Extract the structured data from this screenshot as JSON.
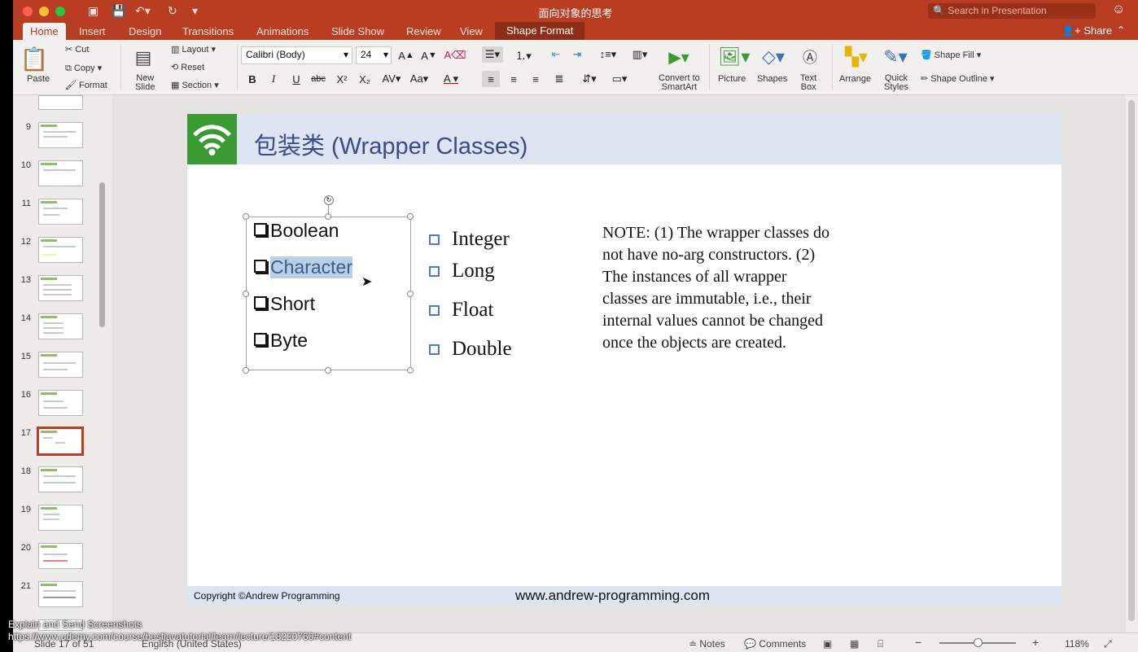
{
  "window": {
    "title": "面向对象的思考",
    "search_placeholder": "Search in Presentation",
    "share_label": "Share"
  },
  "tabs": [
    "Home",
    "Insert",
    "Design",
    "Transitions",
    "Animations",
    "Slide Show",
    "Review",
    "View",
    "Shape Format"
  ],
  "ribbon": {
    "clipboard": {
      "paste": "Paste",
      "cut": "Cut",
      "copy": "Copy",
      "format": "Format"
    },
    "slides": {
      "new_slide": "New Slide",
      "layout": "Layout",
      "reset": "Reset",
      "section": "Section"
    },
    "font": {
      "name": "Calibri (Body)",
      "size": "24",
      "bold": "B",
      "italic": "I",
      "underline": "U",
      "strike": "abc",
      "superscript": "X²",
      "subscript": "X₂"
    },
    "convert": "Convert to SmartArt",
    "picture": "Picture",
    "shapes": "Shapes",
    "textbox": "Text Box",
    "arrange": "Arrange",
    "quick_styles": "Quick Styles",
    "shape_fill": "Shape Fill",
    "shape_outline": "Shape Outline"
  },
  "thumbnails": {
    "numbers": [
      "9",
      "10",
      "11",
      "12",
      "13",
      "14",
      "15",
      "16",
      "17",
      "18",
      "19",
      "20",
      "21"
    ],
    "selected": "17"
  },
  "slide": {
    "title": "包装类 (Wrapper Classes)",
    "box_items": [
      "Boolean",
      "Character",
      "Short",
      "Byte"
    ],
    "list_items": [
      "Integer",
      "Long",
      "Float",
      "Double"
    ],
    "note_lines": [
      "NOTE: (1) The wrapper classes do",
      "not have no-arg constructors. (2)",
      "The instances of all wrapper",
      "classes are immutable, i.e., their",
      "internal values cannot be changed",
      "once the objects are created."
    ],
    "copyright": "Copyright ©Andrew Programming",
    "website": "www.andrew-programming.com"
  },
  "statusbar": {
    "slide_pos": "Slide 17 of 51",
    "language": "English (United States)",
    "notes": "Notes",
    "comments": "Comments",
    "zoom": "118%"
  },
  "overlay": {
    "line1": "Explain and Send Screenshots",
    "line2": "https://www.udemy.com/course/bestjavatutorial/learn/lecture/18220760#content"
  },
  "colors": {
    "accent": "#b93d22",
    "slide_title": "#3b4a8c",
    "logo_green": "#3a9a33",
    "highlight": "#b9cfe8"
  }
}
